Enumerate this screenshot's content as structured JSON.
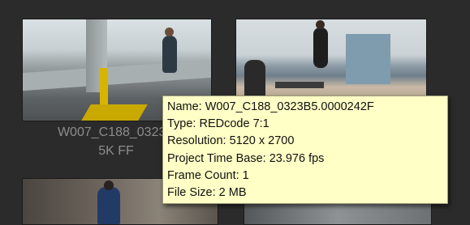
{
  "clips": [
    {
      "caption_line1": "W007_C188_0323B",
      "caption_line2": "5K FF"
    }
  ],
  "tooltip": {
    "name": "Name: W007_C188_0323B5.0000242F",
    "type": "Type: REDcode 7:1",
    "resolution": "Resolution: 5120 x 2700",
    "time_base": "Project Time Base: 23.976 fps",
    "frame_count": "Frame Count: 1",
    "file_size": "File Size: 2 MB"
  },
  "colors": {
    "background": "#2b2b2b",
    "tooltip_bg": "#ffffc6",
    "caption_text": "#8d8d8d"
  }
}
